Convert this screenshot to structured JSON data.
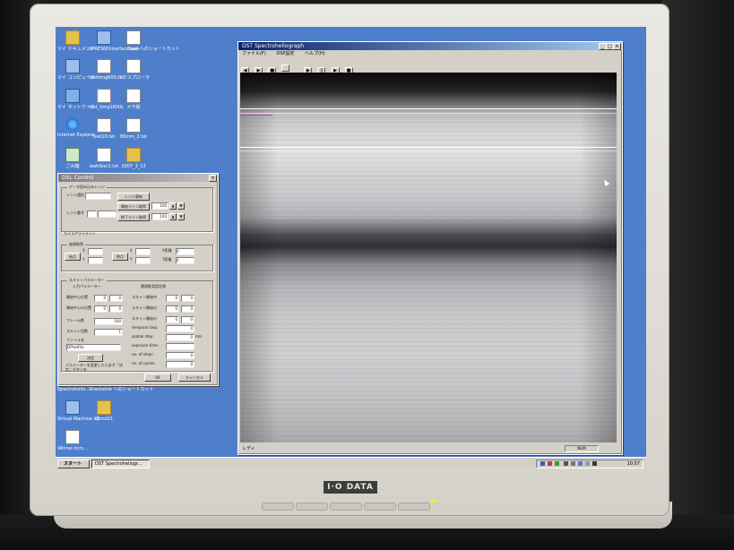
{
  "desktop": {
    "icons": [
      {
        "label": "マイ ドキュメント",
        "glyph": "folder"
      },
      {
        "label": "SPRES60Interface.exe へのショートカット",
        "glyph": "pc"
      },
      {
        "label": "Trash",
        "glyph": "doc"
      },
      {
        "label": "マイ コンピュータ",
        "glyph": "pc"
      },
      {
        "label": "texttimg600.txt",
        "glyph": "doc"
      },
      {
        "label": "エクスプローラ",
        "glyph": "doc"
      },
      {
        "label": "マイ ネットワーク",
        "glyph": "net"
      },
      {
        "label": "test_timg1600L",
        "glyph": "doc"
      },
      {
        "label": "メモ帳",
        "glyph": "doc"
      },
      {
        "label": "Internet Explorer",
        "glyph": "ie"
      },
      {
        "label": "test10.txt",
        "glyph": "doc"
      },
      {
        "label": "80mm_2.txt",
        "glyph": "doc"
      },
      {
        "label": "ごみ箱",
        "glyph": "trash"
      },
      {
        "label": "watriber1.txt",
        "glyph": "doc"
      },
      {
        "label": "2007_3_13",
        "glyph": "folder"
      },
      {
        "label": "Spectrohelio...",
        "glyph": "pc"
      },
      {
        "label": "Shackelrie へのショートカット",
        "glyph": "pc"
      },
      {
        "label": "Virtual Machine X2",
        "glyph": "pc"
      },
      {
        "label": "dlnnd21",
        "glyph": "folder"
      },
      {
        "label": "Winrar-itcrs...",
        "glyph": "doc"
      }
    ]
  },
  "spectro": {
    "title": "DST Spectroheliograph",
    "menu": [
      "ファイル(F)",
      "DSP設定",
      "ヘルプ(H)"
    ],
    "toolbar": [
      "◀",
      "▶",
      "■",
      "",
      "▶",
      "||",
      "▶",
      "■"
    ],
    "status_left": "レディ",
    "status_right": "NUM"
  },
  "control": {
    "title": "DSL Control",
    "lens_group": "データ読み込みレンジ",
    "lens_label": "レンジ選択",
    "lens_update_btn": "レンジ更新",
    "lens_num_label": "レンジ番号",
    "start_line_btn": "開始ライン取得",
    "start_line_val": "100",
    "end_line_btn": "終了ライン取得",
    "end_line_val": "104",
    "camera_group": "カメラアライメント",
    "coord_group": "座標取得",
    "origin_btn": "始点",
    "end_btn": "終点",
    "x_label": "X",
    "y_label": "Y",
    "x_len_label": "X距離",
    "y_len_label": "Y距離",
    "x_len_val": "0",
    "y_len_val": "0",
    "scan_group": "スキャンパラメーター",
    "input_params": "入力パラメーター",
    "calc_params": "関連推奨設定値",
    "start_pos_label": "開始中心位置",
    "end_pos_label": "開始中心の位置",
    "frame_label": "フレーム数",
    "frame_val": "100",
    "scan_count_label": "スキャン回数",
    "scan_count_val": "1",
    "file_label": "ファイル名",
    "file_val": "DPhotFile",
    "set_btn": "決定",
    "note": "パラメーターを変更したら必ず「決定」ボタンを",
    "scan_start_label": "スキャン開始中",
    "scan_end_label": "スキャン開始の",
    "scan_mid_label": "スキャン開始の",
    "temporal_label": "temporal step:",
    "spatial_label": "spatial step:",
    "spatial_unit": "m/s",
    "exposure_label": "exposure time:",
    "nsteps_label": "no. of steps:",
    "ncycles_label": "no. of cycles:",
    "zero": "0",
    "ok_btn": "OK",
    "cancel_btn": "キャンセル"
  },
  "taskbar": {
    "start_label": "スタート",
    "task_label": "DST Spectroheliogr...",
    "clock": "10:57"
  },
  "monitor": {
    "brand": "I·O DATA"
  }
}
